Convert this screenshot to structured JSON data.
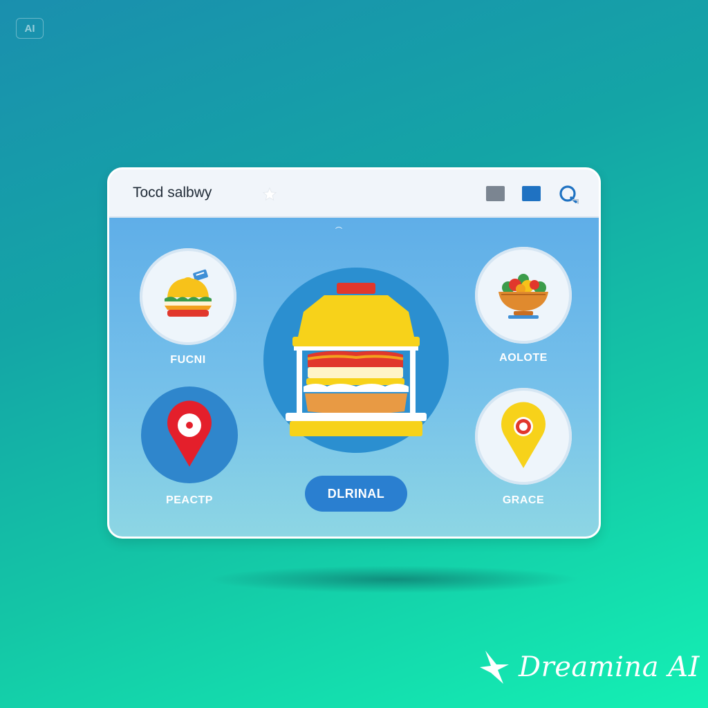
{
  "badge": {
    "text": "AI"
  },
  "window": {
    "title": "Tocd salbwy",
    "colors": {
      "accent": "#2a7fd0",
      "gray_button": "#7b8591",
      "blue_button": "#1f72c2"
    }
  },
  "tiles": [
    {
      "label": "FUCNI",
      "icon": "burger-icon"
    },
    {
      "label": "AOLOTE",
      "icon": "salad-bowl-icon"
    },
    {
      "label": "PEACTP",
      "icon": "location-pin-icon"
    },
    {
      "label": "GRACE",
      "icon": "location-pin-icon"
    }
  ],
  "center": {
    "icon": "food-container-icon",
    "button_label": "DLRINAL"
  },
  "watermark": {
    "text": "Dreamina AI"
  }
}
